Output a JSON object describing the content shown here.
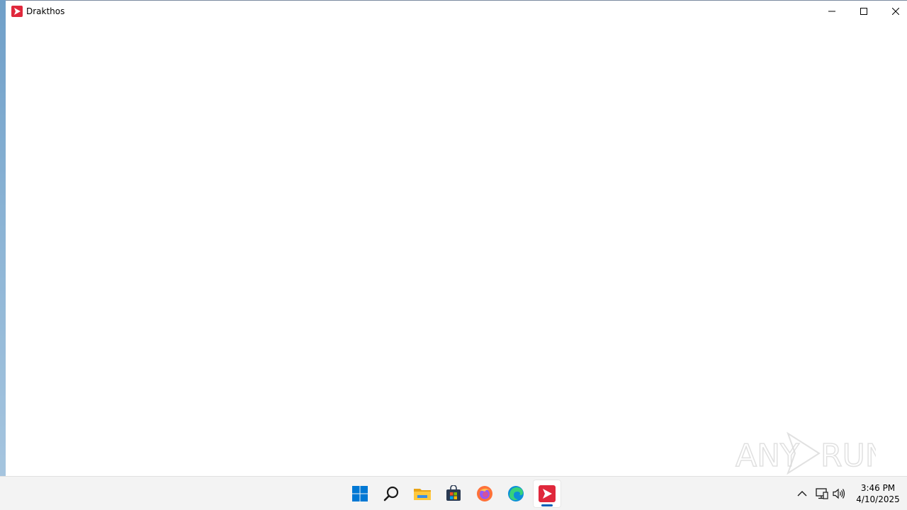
{
  "window": {
    "title": "Drakthos",
    "app_icon": "drakthos-app-icon",
    "controls": {
      "minimize_icon": "minimize-icon",
      "maximize_icon": "maximize-icon",
      "close_icon": "close-icon"
    }
  },
  "watermark": {
    "text_left": "ANY",
    "text_right": "RUN"
  },
  "taskbar": {
    "pinned": [
      {
        "name": "start-button",
        "icon": "windows-start-icon"
      },
      {
        "name": "search-button",
        "icon": "search-icon"
      },
      {
        "name": "file-explorer-button",
        "icon": "folder-icon"
      },
      {
        "name": "microsoft-store-button",
        "icon": "store-icon"
      },
      {
        "name": "firefox-button",
        "icon": "firefox-icon"
      },
      {
        "name": "edge-button",
        "icon": "edge-icon"
      },
      {
        "name": "drakthos-taskbar-button",
        "icon": "drakthos-app-icon",
        "active": true
      }
    ],
    "tray": {
      "overflow_icon": "chevron-up-icon",
      "network_icon": "network-icon",
      "volume_icon": "speaker-icon"
    },
    "clock": {
      "time": "3:46 PM",
      "date": "4/10/2025"
    }
  },
  "colors": {
    "accent": "#005fb8",
    "app_brand": "#e0283c",
    "taskbar_bg": "#f3f3f3"
  }
}
